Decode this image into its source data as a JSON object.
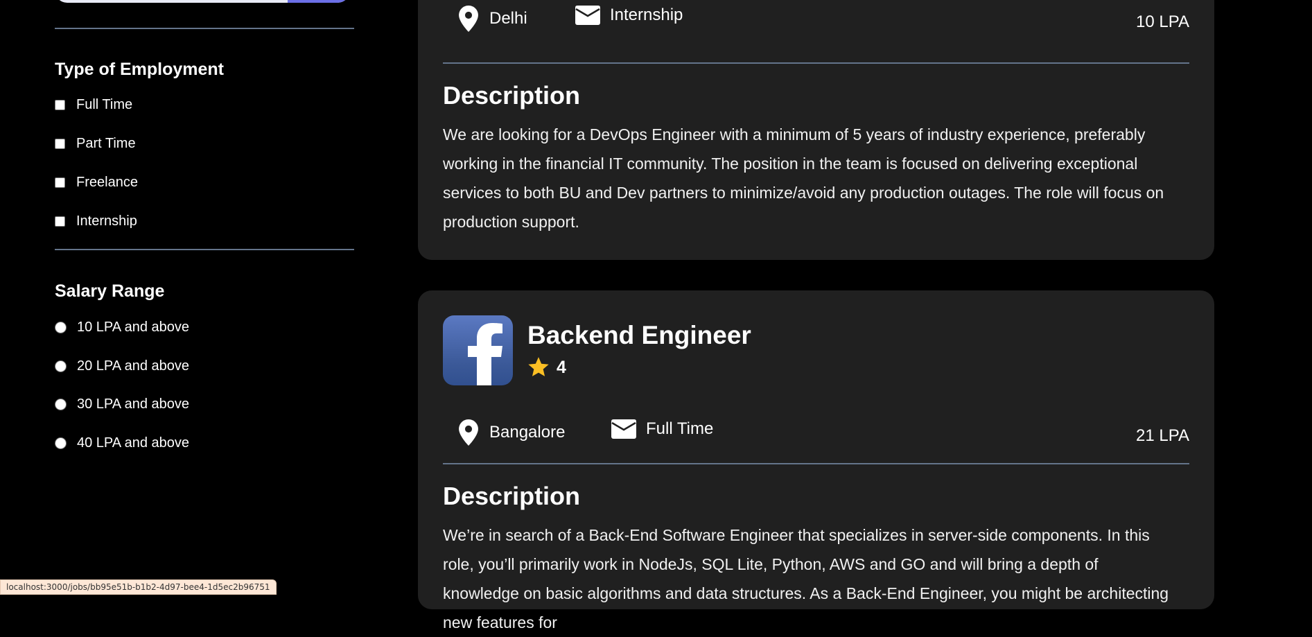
{
  "sidebar": {
    "employment_title": "Type of Employment",
    "employment_options": [
      "Full Time",
      "Part Time",
      "Freelance",
      "Internship"
    ],
    "salary_title": "Salary Range",
    "salary_options": [
      "10 LPA and above",
      "20 LPA and above",
      "30 LPA and above",
      "40 LPA and above"
    ]
  },
  "job1": {
    "location": "Delhi",
    "employment_type": "Internship",
    "package": "10 LPA",
    "description_title": "Description",
    "description": "We are looking for a DevOps Engineer with a minimum of 5 years of industry experience, preferably working in the financial IT community. The position in the team is focused on delivering exceptional services to both BU and Dev partners to minimize/avoid any production outages. The role will focus on production support."
  },
  "job2": {
    "title": "Backend Engineer",
    "rating": "4",
    "location": "Bangalore",
    "employment_type": "Full Time",
    "package": "21 LPA",
    "description_title": "Description",
    "description": "We’re in search of a Back-End Software Engineer that specializes in server-side components. In this role, you’ll primarily work in NodeJs, SQL Lite, Python, AWS and GO and will bring a depth of knowledge on basic algorithms and data structures. As a Back-End Engineer, you might be architecting new features for"
  },
  "status_bar": {
    "url": "localhost:3000/jobs/bb95e51b-b1b2-4d97-bee4-1d5ec2b96751"
  },
  "colors": {
    "page_bg": "#000000",
    "card_bg": "#202020",
    "separator": "#64748b",
    "star": "#fbbf24",
    "facebook_blue": "#3b5998"
  }
}
